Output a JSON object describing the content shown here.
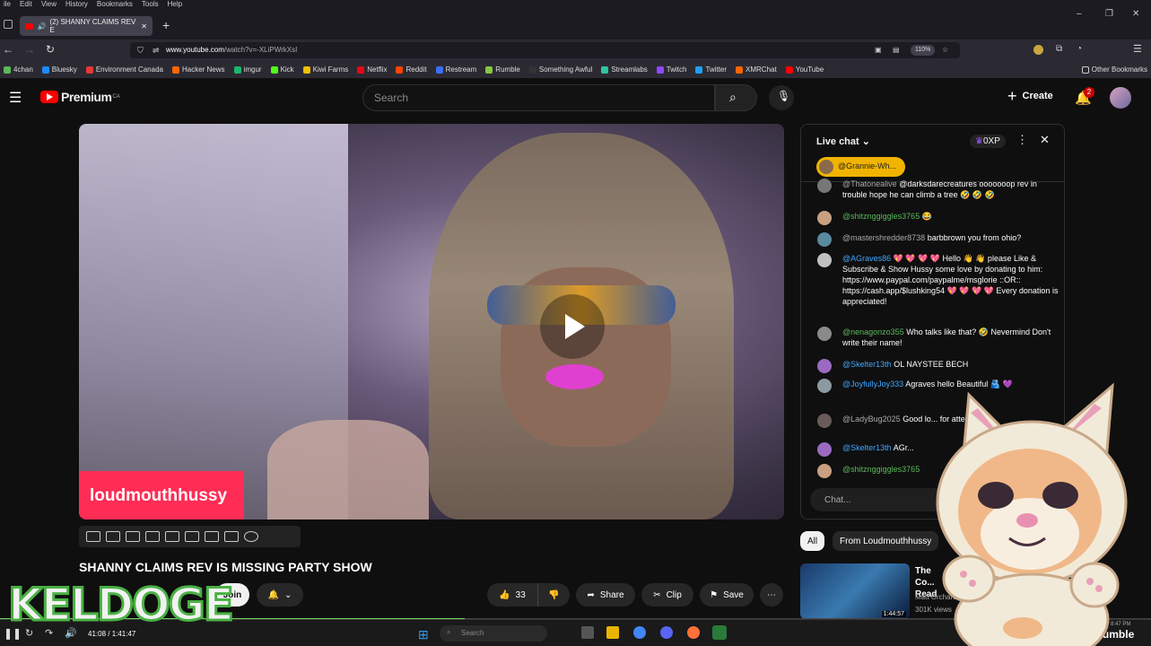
{
  "browser": {
    "menu": [
      "ile",
      "Edit",
      "View",
      "History",
      "Bookmarks",
      "Tools",
      "Help"
    ],
    "tab_title": "(2) SHANNY CLAIMS REV E",
    "url_host": "www.youtube.com",
    "url_path": "/watch?v=-XLiPWrkXsI",
    "zoom": "110%",
    "bookmarks": [
      {
        "label": "4chan",
        "color": "#5cb85c"
      },
      {
        "label": "Bluesky",
        "color": "#1d8cf8"
      },
      {
        "label": "Environment Canada",
        "color": "#e53935"
      },
      {
        "label": "Hacker News",
        "color": "#ff6600"
      },
      {
        "label": "imgur",
        "color": "#1bb76e"
      },
      {
        "label": "Kick",
        "color": "#53fc18"
      },
      {
        "label": "Kiwi Farms",
        "color": "#f0c000"
      },
      {
        "label": "Netflix",
        "color": "#e50914"
      },
      {
        "label": "Reddit",
        "color": "#ff4500"
      },
      {
        "label": "Restream",
        "color": "#3b6ef5"
      },
      {
        "label": "Rumble",
        "color": "#85c742"
      },
      {
        "label": "Something Awful",
        "color": "#333333"
      },
      {
        "label": "Streamlabs",
        "color": "#31c3a2"
      },
      {
        "label": "Twitch",
        "color": "#9146ff"
      },
      {
        "label": "Twitter",
        "color": "#1da1f2"
      },
      {
        "label": "XMRChat",
        "color": "#ff6600"
      },
      {
        "label": "YouTube",
        "color": "#ff0000"
      }
    ],
    "other_bookmarks": "Other Bookmarks"
  },
  "youtube": {
    "logo_text": "Premium",
    "logo_region": "CA",
    "search_placeholder": "Search",
    "create_label": "Create",
    "notif_count": "2"
  },
  "video": {
    "name_tag": "loudmouthhussy",
    "title": "SHANNY CLAIMS REV IS MISSING PARTY SHOW",
    "join_label": "Join",
    "like_count": "33",
    "share_label": "Share",
    "clip_label": "Clip",
    "save_label": "Save",
    "time": "41:08 / 1:41:47",
    "progress_percent": 40.4
  },
  "chat": {
    "title": "Live chat",
    "xp": "0XP",
    "pinned_user": "@Grannie-Wh...",
    "input_placeholder": "Chat...",
    "messages": [
      {
        "user": "@Thatonealive",
        "text": "@darksdarecreatures ooooooop rev in trouble hope he can climb a tree 🤣 🤣 🤣",
        "color": "#777"
      },
      {
        "user": "@shitznggiggles3765",
        "text": "😂",
        "color": "#c8a080",
        "cls": "g"
      },
      {
        "user": "@mastershredder8738",
        "text": "barbbrown you from ohio?",
        "color": "#5a8aa0",
        "cls": "gr"
      },
      {
        "user": "@AGraves86",
        "text": "💖 💖 💖 💖 Hello 👋 👋 please Like & Subscribe & Show Hussy some love by donating to him: https://www.paypal.com/paypalme/msglorie ::OR:: https://cash.app/$lushking54 💖 💖 💖 💖 Every donation is appreciated!",
        "color": "#c0c0c0"
      },
      {
        "user": "@nenagonzo355",
        "text": "Who talks like that? 🤣 Nevermind Don't write their name!",
        "color": "#8a8a8a",
        "cls": "g"
      },
      {
        "user": "@Skelter13th",
        "text": "OL NAYSTEE BECH",
        "color": "#9a6ac0"
      },
      {
        "user": "@JoyfullyJoy333",
        "text": "Agraves hello Beautiful 🫂 💜",
        "color": "#8a9aa0"
      },
      {
        "user": "@LadyBug2025",
        "text": "Good lo... for attention",
        "color": "#6a5a5a",
        "cls": "gr"
      },
      {
        "user": "@Skelter13th",
        "text": "AGr...",
        "color": "#9a6ac0"
      },
      {
        "user": "@shitznggiggles3765",
        "text": "",
        "color": "#c8a080",
        "cls": "g"
      }
    ]
  },
  "related": {
    "chip_all": "All",
    "chip_from": "From Loudmouthhussy",
    "video_title": "The Co... Read",
    "channel": "Matt Orchard",
    "views": "301K views",
    "duration": "1:44:57"
  },
  "overlay": {
    "keldoge": "KELDOGE",
    "rumble": "rumble",
    "clock": "8:47 PM"
  },
  "taskbar": {
    "search": "Search"
  }
}
